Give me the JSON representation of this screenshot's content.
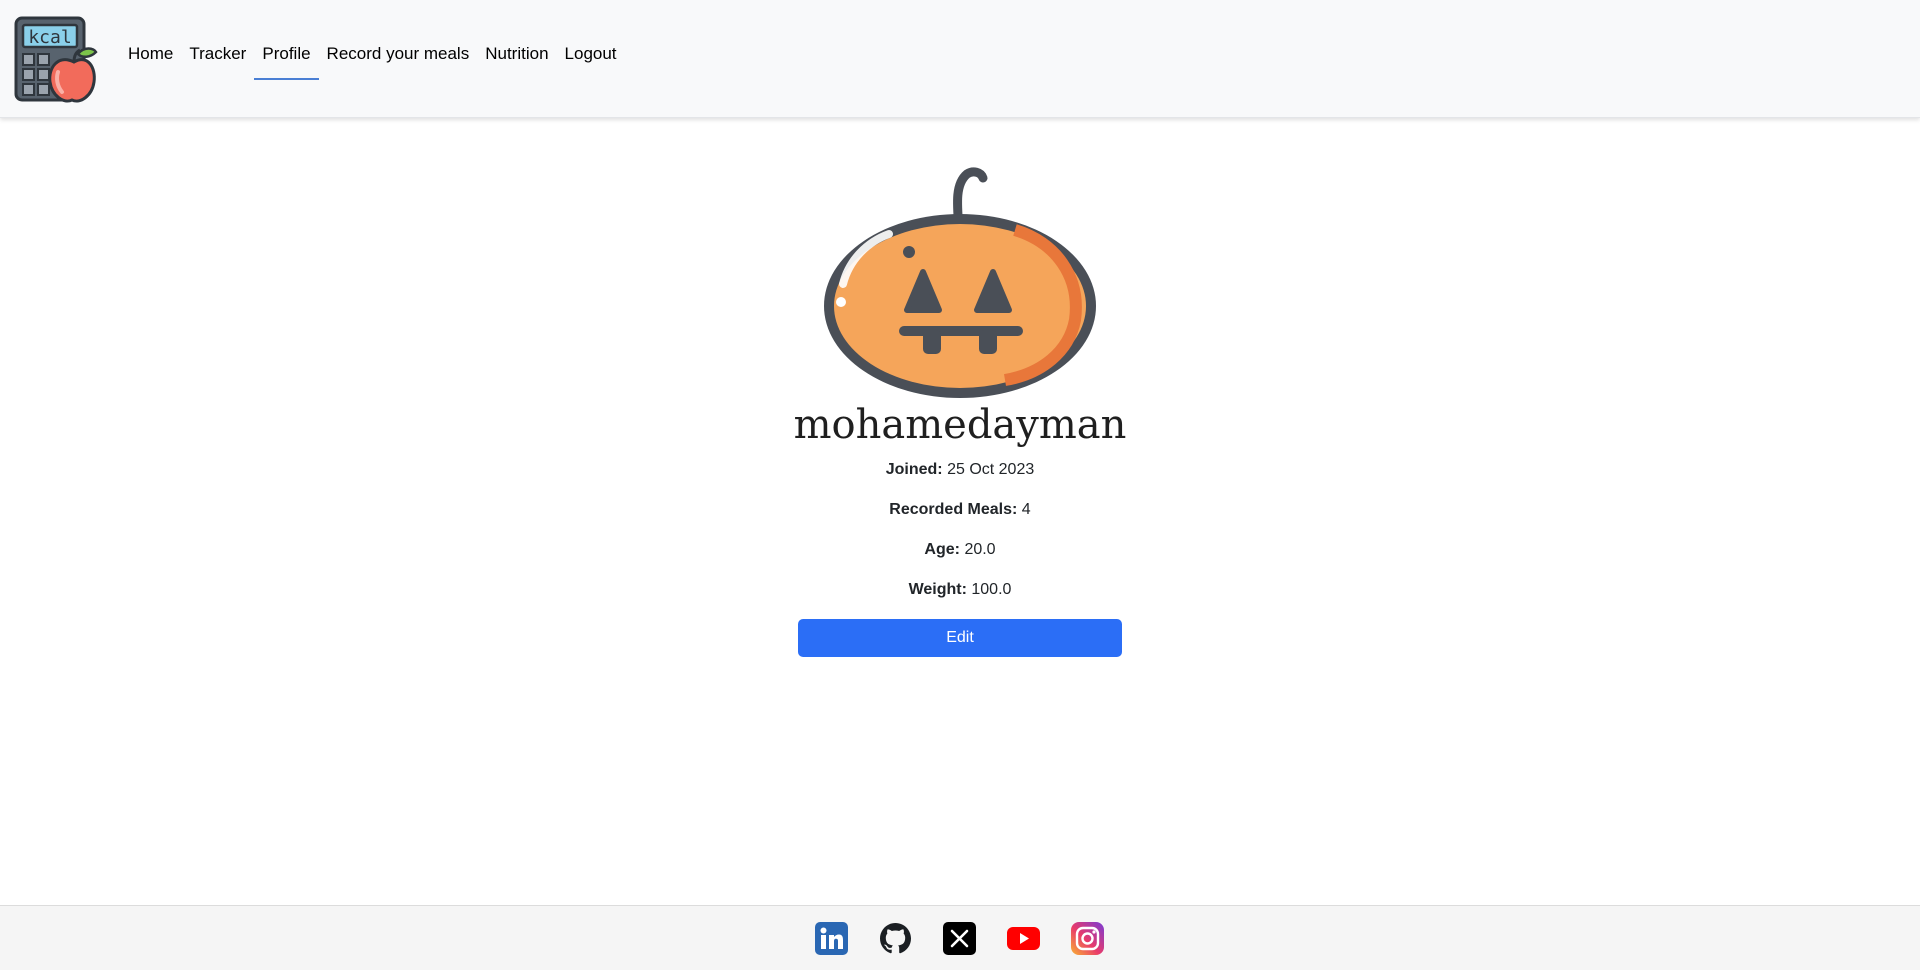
{
  "nav": {
    "logo_text": "kcal",
    "links": [
      {
        "label": "Home",
        "active": false
      },
      {
        "label": "Tracker",
        "active": false
      },
      {
        "label": "Profile",
        "active": true
      },
      {
        "label": "Record your meals",
        "active": false
      },
      {
        "label": "Nutrition",
        "active": false
      },
      {
        "label": "Logout",
        "active": false
      }
    ]
  },
  "profile": {
    "username": "mohamedayman",
    "joined_label": "Joined:",
    "joined_value": "25 Oct 2023",
    "meals_label": "Recorded Meals:",
    "meals_value": "4",
    "age_label": "Age:",
    "age_value": "20.0",
    "weight_label": "Weight:",
    "weight_value": "100.0",
    "edit_label": "Edit"
  },
  "footer": {
    "socials": [
      "linkedin-icon",
      "github-icon",
      "x-icon",
      "youtube-icon",
      "instagram-icon"
    ]
  },
  "colors": {
    "accent": "#2b6ef6",
    "nav_active_underline": "#4a7fd4",
    "pumpkin": "#f5a55a"
  }
}
